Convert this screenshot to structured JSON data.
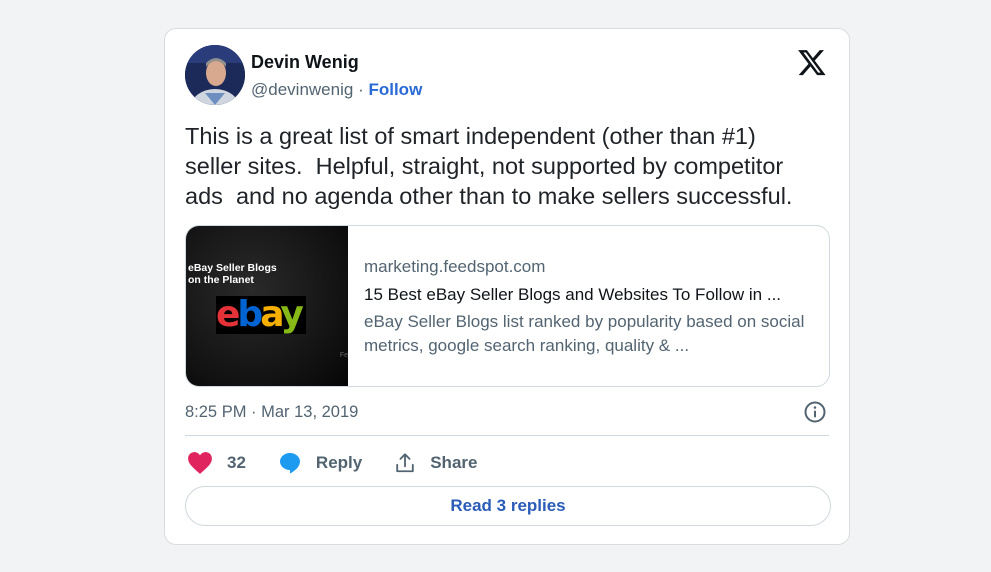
{
  "author": {
    "name": "Devin Wenig",
    "handle": "@devinwenig",
    "separator": "·",
    "follow_label": "Follow"
  },
  "tweet": {
    "text": "This is a great list of smart independent (other than #1)\nseller sites.  Helpful, straight, not supported by competitor\nads  and no agenda other than to make sellers successful."
  },
  "card": {
    "thumbnail": {
      "title": "eBay Seller Blogs\non the Planet",
      "logo_text": "ebay",
      "mark": "Fe"
    },
    "domain": "marketing.feedspot.com",
    "title": "15 Best eBay Seller Blogs and Websites To Follow in ...",
    "description": "eBay Seller Blogs list ranked by popularity based on social metrics, google search ranking, quality & ..."
  },
  "meta": {
    "timestamp": "8:25 PM · Mar 13, 2019"
  },
  "actions": {
    "likes_count": "32",
    "reply_label": "Reply",
    "share_label": "Share"
  },
  "replies_button_label": "Read 3 replies",
  "colors": {
    "like": "#e0245e",
    "reply": "#1d9bf0",
    "link": "#2a6ad5"
  },
  "icons": [
    "x-logo-icon",
    "info-icon",
    "heart-icon",
    "speech-bubble-icon",
    "share-icon"
  ]
}
